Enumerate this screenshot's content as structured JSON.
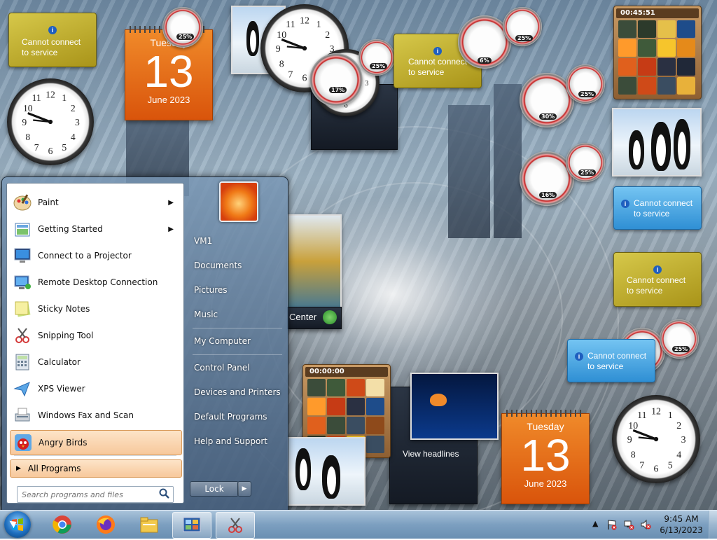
{
  "desktop": {
    "calendar_1": {
      "weekday": "Tuesday",
      "day": "13",
      "month_year": "June 2023"
    },
    "calendar_2": {
      "weekday": "Tuesday",
      "day": "13",
      "month_year": "June 2023"
    },
    "weather_message_line1": "Cannot connect",
    "weather_message_line2": "to service",
    "cpu_meters": [
      "25%",
      "17%",
      "25%",
      "6%",
      "25%",
      "25%",
      "30%",
      "16%",
      "25%",
      "25%"
    ],
    "puzzle_timer_top": "00:45:51",
    "puzzle_timer_bottom": "00:00:00",
    "media_center_label": "Center",
    "feed_headlines": "View headlines"
  },
  "start_menu": {
    "programs": [
      {
        "label": "Paint",
        "icon": "paint-icon",
        "has_submenu": true
      },
      {
        "label": "Getting Started",
        "icon": "getting-started-icon",
        "has_submenu": true
      },
      {
        "label": "Connect to a Projector",
        "icon": "projector-icon",
        "has_submenu": false
      },
      {
        "label": "Remote Desktop Connection",
        "icon": "remote-desktop-icon",
        "has_submenu": false
      },
      {
        "label": "Sticky Notes",
        "icon": "sticky-notes-icon",
        "has_submenu": false
      },
      {
        "label": "Snipping Tool",
        "icon": "snipping-tool-icon",
        "has_submenu": false
      },
      {
        "label": "Calculator",
        "icon": "calculator-icon",
        "has_submenu": false
      },
      {
        "label": "XPS Viewer",
        "icon": "xps-viewer-icon",
        "has_submenu": false
      },
      {
        "label": "Windows Fax and Scan",
        "icon": "fax-scan-icon",
        "has_submenu": false
      },
      {
        "label": "Angry Birds",
        "icon": "angry-birds-icon",
        "has_submenu": false
      }
    ],
    "all_programs": "All Programs",
    "search_placeholder": "Search programs and files",
    "right_links": [
      "VM1",
      "Documents",
      "Pictures",
      "Music",
      "My Computer",
      "Control Panel",
      "Devices and Printers",
      "Default Programs",
      "Help and Support"
    ],
    "lock_label": "Lock"
  },
  "taskbar": {
    "pinned": [
      "chrome-icon",
      "firefox-icon",
      "file-explorer-icon",
      "gadgets-icon",
      "snipping-tool-icon"
    ],
    "time": "9:45 AM",
    "date": "6/13/2023"
  }
}
